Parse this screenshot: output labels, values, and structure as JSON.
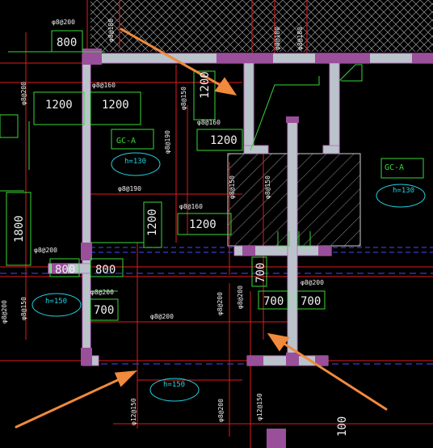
{
  "palette": {
    "background": "#000000",
    "wall_fill": "#b9c4ca",
    "wall_outline": "#c86ec8",
    "column_fill": "#9a4f9a",
    "rebar_line": "#e01c1c",
    "dimension_line": "#37d837",
    "label_cyan": "#22d3e0",
    "axis_blue": "#3b3bd8",
    "annotation_arrow": "#f08a3c"
  },
  "dimensions": {
    "d800_top": "800",
    "d1200_a": "1200",
    "d1200_b": "1200",
    "d1200_c": "1200",
    "d1200_d": "1200",
    "d1200_v1": "1200",
    "d1200_v2": "1200",
    "d1800_v": "1800",
    "d800_mid_a": "800",
    "d800_mid_b": "800",
    "d700_a": "700",
    "d700_b": "700",
    "d700_c": "700",
    "d700_v": "700",
    "d100_v": "100"
  },
  "rebar_labels": {
    "top_left": "φ8@200",
    "top_mid": "φ8@180",
    "top_right_a": "φ8@180",
    "top_right_b": "φ8@180",
    "left_v": "φ8@200",
    "l1": "φ8@160",
    "l2": "φ8@150",
    "l3": "φ8@160",
    "l4": "φ8@190",
    "l5": "φ8@190",
    "l6": "φ8@150",
    "l7": "φ8@150",
    "l8": "φ8@160",
    "l9": "φ8@200",
    "l10": "φ8@200",
    "l11": "φ8@200",
    "l12": "φ8@200",
    "l13": "φ8@200",
    "l14": "φ8@200",
    "l15": "φ8@150",
    "l16": "φ8@200",
    "l17": "φ12@150",
    "l18": "φ8@200",
    "l19": "φ12@150"
  },
  "labels": {
    "gc_a_left": "GC-A",
    "gc_a_right": "GC-A",
    "h130_left": "h=130",
    "h130_right": "h=130",
    "h150_left": "h=150",
    "h150_bottom": "h=150"
  }
}
